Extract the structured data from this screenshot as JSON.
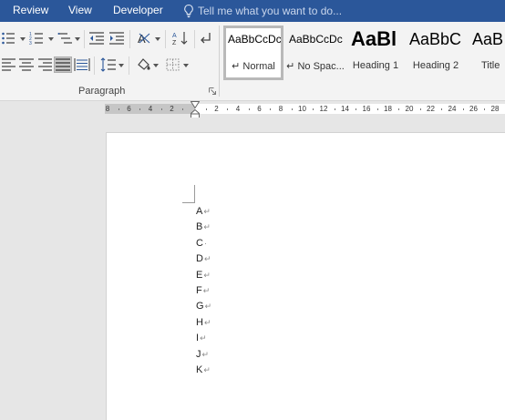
{
  "tabs": {
    "review": "Review",
    "view": "View",
    "developer": "Developer"
  },
  "tell_me": {
    "placeholder": "Tell me what you want to do..."
  },
  "ribbon": {
    "paragraph_group_label": "Paragraph",
    "styles": [
      {
        "preview": "AaBbCcDc",
        "name": "↵ Normal",
        "selected": true
      },
      {
        "preview": "AaBbCcDc",
        "name": "↵ No Spac...",
        "selected": false
      },
      {
        "preview": "AaBl",
        "name": "Heading 1",
        "selected": false
      },
      {
        "preview": "AaBbC",
        "name": "Heading 2",
        "selected": false
      },
      {
        "preview": "AaB",
        "name": "Title",
        "selected": false
      }
    ]
  },
  "ruler": {
    "labels": [
      "8",
      "6",
      "4",
      "2",
      "",
      "2",
      "4",
      "6",
      "8",
      "10",
      "12",
      "14",
      "16",
      "18",
      "20",
      "22",
      "24",
      "26",
      "28"
    ]
  },
  "document": {
    "lines": [
      {
        "text": "A",
        "mark": "↵"
      },
      {
        "text": "B",
        "mark": "↵"
      },
      {
        "text": "C",
        "mark": "·"
      },
      {
        "text": "D",
        "mark": "↵"
      },
      {
        "text": "E",
        "mark": "↵"
      },
      {
        "text": "F",
        "mark": "↵"
      },
      {
        "text": "G",
        "mark": "↵"
      },
      {
        "text": "H",
        "mark": "↵"
      },
      {
        "text": "I",
        "mark": "↵"
      },
      {
        "text": "J",
        "mark": "↵"
      },
      {
        "text": "K",
        "mark": "↵"
      }
    ]
  },
  "colors": {
    "tab_bar": "#2b579a",
    "ribbon": "#f3f3f3",
    "workspace": "#e6e6e6",
    "page": "#ffffff"
  },
  "icons": [
    "lightbulb-icon",
    "bullets-icon",
    "numbering-icon",
    "multilevel-list-icon",
    "decrease-indent-icon",
    "increase-indent-icon",
    "sort-icon",
    "show-marks-icon",
    "align-left-icon",
    "align-center-icon",
    "align-right-icon",
    "justify-icon",
    "distributed-icon",
    "line-spacing-icon",
    "shading-icon",
    "borders-icon",
    "dialog-launcher-icon"
  ]
}
